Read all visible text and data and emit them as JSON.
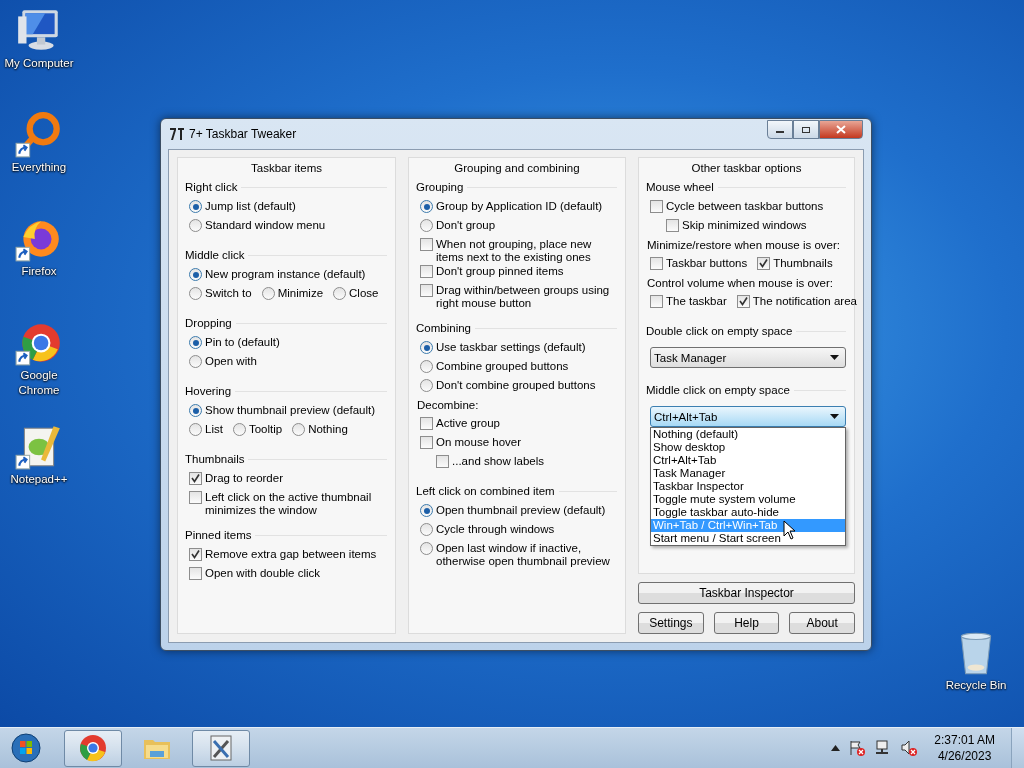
{
  "desktop_icons": [
    {
      "label": "My Computer",
      "kind": "computer",
      "shortcut": false
    },
    {
      "label": "Everything",
      "kind": "ring",
      "shortcut": true
    },
    {
      "label": "Firefox",
      "kind": "fox",
      "shortcut": true
    },
    {
      "label": "Google Chrome",
      "kind": "chrome",
      "shortcut": true
    },
    {
      "label": "Notepad++",
      "kind": "notepad",
      "shortcut": true
    }
  ],
  "recycle_bin": {
    "label": "Recycle Bin"
  },
  "window": {
    "title": "7+ Taskbar Tweaker",
    "columns": [
      {
        "title": "Taskbar items",
        "groups": [
          {
            "title": "Right click",
            "rows": [
              [
                {
                  "kind": "radio",
                  "label": "Jump list (default)",
                  "checked": true
                }
              ],
              [
                {
                  "kind": "radio",
                  "label": "Standard window menu",
                  "checked": false
                }
              ]
            ]
          },
          {
            "title": "Middle click",
            "rows": [
              [
                {
                  "kind": "radio",
                  "label": "New program instance (default)",
                  "checked": true
                }
              ],
              [
                {
                  "kind": "radio",
                  "label": "Switch to",
                  "checked": false
                },
                {
                  "kind": "radio",
                  "label": "Minimize",
                  "checked": false
                },
                {
                  "kind": "radio",
                  "label": "Close",
                  "checked": false
                }
              ]
            ]
          },
          {
            "title": "Dropping",
            "rows": [
              [
                {
                  "kind": "radio",
                  "label": "Pin to (default)",
                  "checked": true
                }
              ],
              [
                {
                  "kind": "radio",
                  "label": "Open with",
                  "checked": false
                }
              ]
            ]
          },
          {
            "title": "Hovering",
            "rows": [
              [
                {
                  "kind": "radio",
                  "label": "Show thumbnail preview (default)",
                  "checked": true
                }
              ],
              [
                {
                  "kind": "radio",
                  "label": "List",
                  "checked": false
                },
                {
                  "kind": "radio",
                  "label": "Tooltip",
                  "checked": false
                },
                {
                  "kind": "radio",
                  "label": "Nothing",
                  "checked": false
                }
              ]
            ]
          },
          {
            "title": "Thumbnails",
            "rows": [
              [
                {
                  "kind": "check",
                  "label": "Drag to reorder",
                  "checked": true
                }
              ],
              [
                {
                  "kind": "check",
                  "label": "Left click on the active thumbnail minimizes the window",
                  "checked": false
                }
              ]
            ]
          },
          {
            "title": "Pinned items",
            "rows": [
              [
                {
                  "kind": "check",
                  "label": "Remove extra gap between items",
                  "checked": true
                }
              ],
              [
                {
                  "kind": "check",
                  "label": "Open with double click",
                  "checked": false
                }
              ]
            ]
          }
        ]
      },
      {
        "title": "Grouping and combining",
        "groups": [
          {
            "title": "Grouping",
            "rows": [
              [
                {
                  "kind": "radio",
                  "label": "Group by Application ID (default)",
                  "checked": true
                }
              ],
              [
                {
                  "kind": "radio",
                  "label": "Don't group",
                  "checked": false
                }
              ],
              [
                {
                  "kind": "check",
                  "label": "When not grouping, place new items next to the existing ones",
                  "checked": false
                }
              ],
              [
                {
                  "kind": "check",
                  "label": "Don't group pinned items",
                  "checked": false
                }
              ],
              [
                {
                  "kind": "check",
                  "label": "Drag within/between groups using right mouse button",
                  "checked": false
                }
              ]
            ]
          },
          {
            "title": "Combining",
            "rows": [
              [
                {
                  "kind": "radio",
                  "label": "Use taskbar settings (default)",
                  "checked": true
                }
              ],
              [
                {
                  "kind": "radio",
                  "label": "Combine grouped buttons",
                  "checked": false
                }
              ],
              [
                {
                  "kind": "radio",
                  "label": "Don't combine grouped buttons",
                  "checked": false
                }
              ],
              [
                {
                  "kind": "label",
                  "label": "Decombine:"
                }
              ],
              [
                {
                  "kind": "check",
                  "label": "Active group",
                  "checked": false
                }
              ],
              [
                {
                  "kind": "check",
                  "label": "On mouse hover",
                  "checked": false,
                  "children": [
                    {
                      "kind": "check",
                      "label": "...and show labels",
                      "checked": false
                    }
                  ]
                }
              ]
            ]
          },
          {
            "title": "Left click on combined item",
            "rows": [
              [
                {
                  "kind": "radio",
                  "label": "Open thumbnail preview (default)",
                  "checked": true
                }
              ],
              [
                {
                  "kind": "radio",
                  "label": "Cycle through windows",
                  "checked": false
                }
              ],
              [
                {
                  "kind": "radio",
                  "label": "Open last window if inactive, otherwise open thumbnail preview",
                  "checked": false
                }
              ]
            ]
          }
        ]
      },
      {
        "title": "Other taskbar options",
        "groups": [
          {
            "title": "Mouse wheel",
            "rows": [
              [
                {
                  "kind": "check",
                  "label": "Cycle between taskbar buttons",
                  "checked": false,
                  "children": [
                    {
                      "kind": "check",
                      "label": "Skip minimized windows",
                      "checked": false
                    }
                  ]
                }
              ],
              [
                {
                  "kind": "label",
                  "label": "Minimize/restore when mouse is over:"
                }
              ],
              [
                {
                  "kind": "check",
                  "label": "Taskbar buttons",
                  "checked": false
                },
                {
                  "kind": "check",
                  "label": "Thumbnails",
                  "checked": true
                }
              ],
              [
                {
                  "kind": "label",
                  "label": "Control volume when mouse is over:"
                }
              ],
              [
                {
                  "kind": "check",
                  "label": "The taskbar",
                  "checked": false
                },
                {
                  "kind": "check",
                  "label": "The notification area",
                  "checked": true
                }
              ]
            ]
          },
          {
            "title": "Double click on empty space",
            "rows": [
              [
                {
                  "kind": "select",
                  "value": "Task Manager",
                  "expanded": false
                }
              ]
            ]
          },
          {
            "title": "Middle click on empty space",
            "rows": [
              [
                {
                  "kind": "select",
                  "value": "Ctrl+Alt+Tab",
                  "expanded": true,
                  "options": [
                    {
                      "label": "Nothing (default)",
                      "highlighted": false
                    },
                    {
                      "label": "Show desktop",
                      "highlighted": false
                    },
                    {
                      "label": "Ctrl+Alt+Tab",
                      "highlighted": false
                    },
                    {
                      "label": "Task Manager",
                      "highlighted": false
                    },
                    {
                      "label": "Taskbar Inspector",
                      "highlighted": false
                    },
                    {
                      "label": "Toggle mute system volume",
                      "highlighted": false
                    },
                    {
                      "label": "Toggle taskbar auto-hide",
                      "highlighted": false
                    },
                    {
                      "label": "Win+Tab / Ctrl+Win+Tab",
                      "highlighted": true
                    },
                    {
                      "label": "Start menu / Start screen",
                      "highlighted": false
                    }
                  ]
                }
              ]
            ]
          }
        ],
        "wide_button": "Taskbar Inspector",
        "buttons": [
          "Settings",
          "Help",
          "About"
        ]
      }
    ]
  },
  "taskbar": {
    "pinned": [
      {
        "kind": "chrome",
        "running": true
      },
      {
        "kind": "folder",
        "running": false
      },
      {
        "kind": "tweaker",
        "running": true
      }
    ],
    "clock": {
      "time": "2:37:01 AM",
      "date": "4/26/2023"
    }
  }
}
